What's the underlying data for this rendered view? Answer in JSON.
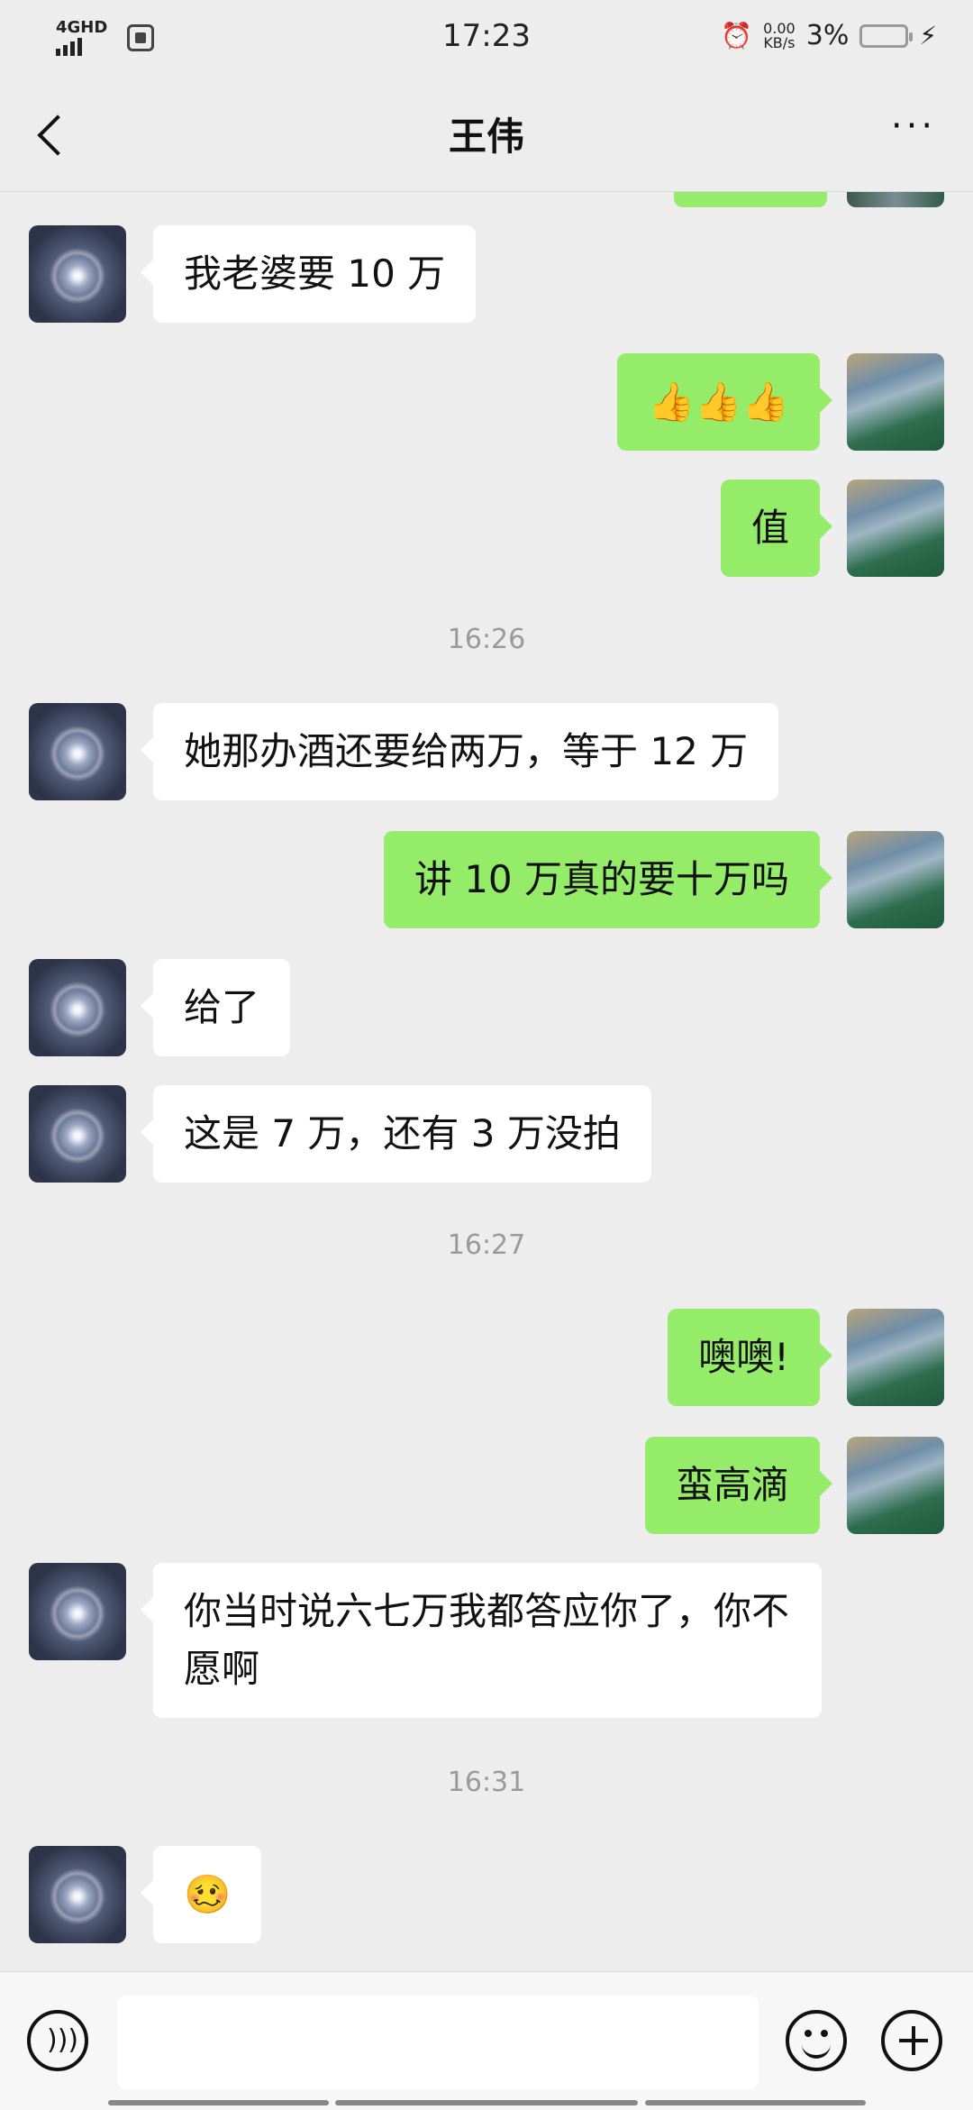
{
  "status": {
    "network": "4GHD",
    "time": "17:23",
    "speed_value": "0.00",
    "speed_unit": "KB/s",
    "battery_pct": "3%"
  },
  "header": {
    "title": "王伟"
  },
  "messages": [
    {
      "type": "in",
      "text": "我老婆要 10 万"
    },
    {
      "type": "out",
      "text": "👍👍👍"
    },
    {
      "type": "out",
      "text": "值"
    },
    {
      "type": "time",
      "text": "16:26"
    },
    {
      "type": "in",
      "text": "她那办酒还要给两万，等于 12 万"
    },
    {
      "type": "out",
      "text": "讲 10 万真的要十万吗"
    },
    {
      "type": "in",
      "text": "给了"
    },
    {
      "type": "in",
      "text": "这是 7 万，还有 3 万没拍"
    },
    {
      "type": "time",
      "text": "16:27"
    },
    {
      "type": "out",
      "text": "噢噢!"
    },
    {
      "type": "out",
      "text": "蛮高滴"
    },
    {
      "type": "in",
      "text": "你当时说六七万我都答应你了，你不愿啊"
    },
    {
      "type": "time",
      "text": "16:31"
    },
    {
      "type": "in",
      "text": "🥴"
    }
  ],
  "colors": {
    "background": "#ededed",
    "outgoing_bubble": "#95ec69",
    "incoming_bubble": "#ffffff"
  },
  "icons": [
    "back-arrow-icon",
    "more-icon",
    "voice-icon",
    "emoji-icon",
    "plus-icon"
  ]
}
